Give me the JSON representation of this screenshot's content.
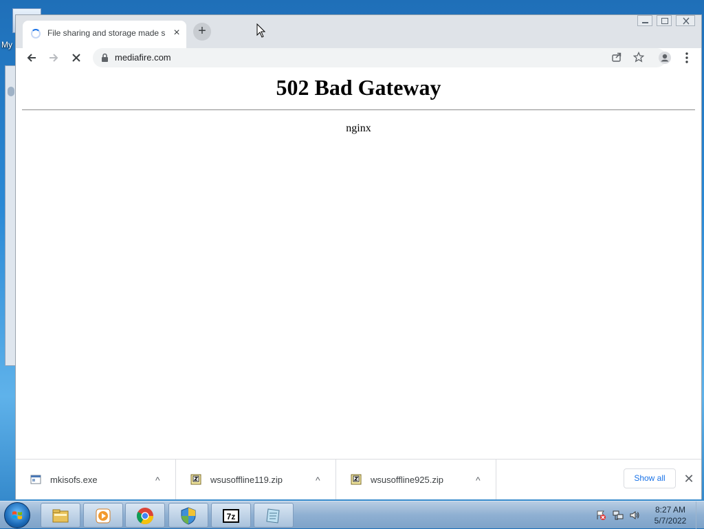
{
  "desktop": {
    "icon_label": "My"
  },
  "browser": {
    "tab": {
      "title": "File sharing and storage made simple"
    },
    "new_tab_label": "+",
    "tab_close_label": "×",
    "address": {
      "url": "mediafire.com"
    }
  },
  "page": {
    "heading": "502 Bad Gateway",
    "server": "nginx"
  },
  "downloads": {
    "items": [
      {
        "name": "mkisofs.exe",
        "icon": "exe-file-icon"
      },
      {
        "name": "wsusoffline119.zip",
        "icon": "zip-file-icon"
      },
      {
        "name": "wsusoffline925.zip",
        "icon": "zip-file-icon"
      }
    ],
    "show_all_label": "Show all",
    "close_label": "✕"
  },
  "taskbar": {
    "apps": [
      "file-explorer-icon",
      "media-player-icon",
      "chrome-icon",
      "security-shield-icon",
      "7zip-icon",
      "notepad-icon"
    ],
    "clock": {
      "time": "8:27 AM",
      "date": "5/7/2022"
    }
  },
  "colors": {
    "accent": "#1a73e8",
    "titlebar": "#dfe3e8",
    "omnibox": "#f1f3f4"
  }
}
